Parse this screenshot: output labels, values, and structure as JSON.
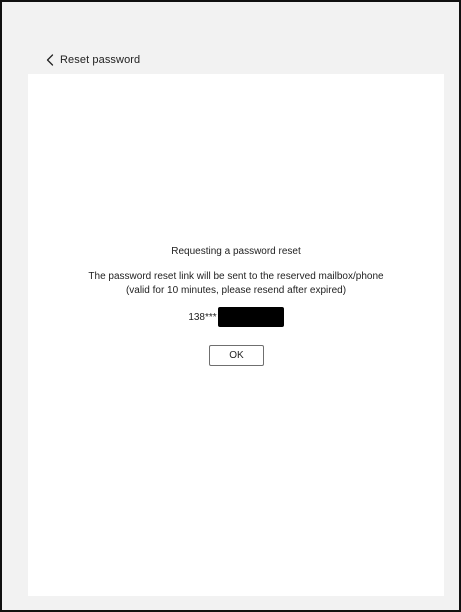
{
  "header": {
    "back_icon": "chevron-left-icon",
    "title": "Reset password"
  },
  "dialog": {
    "title": "Requesting a password reset",
    "line1": "The password reset link will be sent to the reserved mailbox/phone",
    "line2": "(valid for 10 minutes, please resend after expired)",
    "contact_prefix": "138***",
    "ok_label": "OK"
  }
}
